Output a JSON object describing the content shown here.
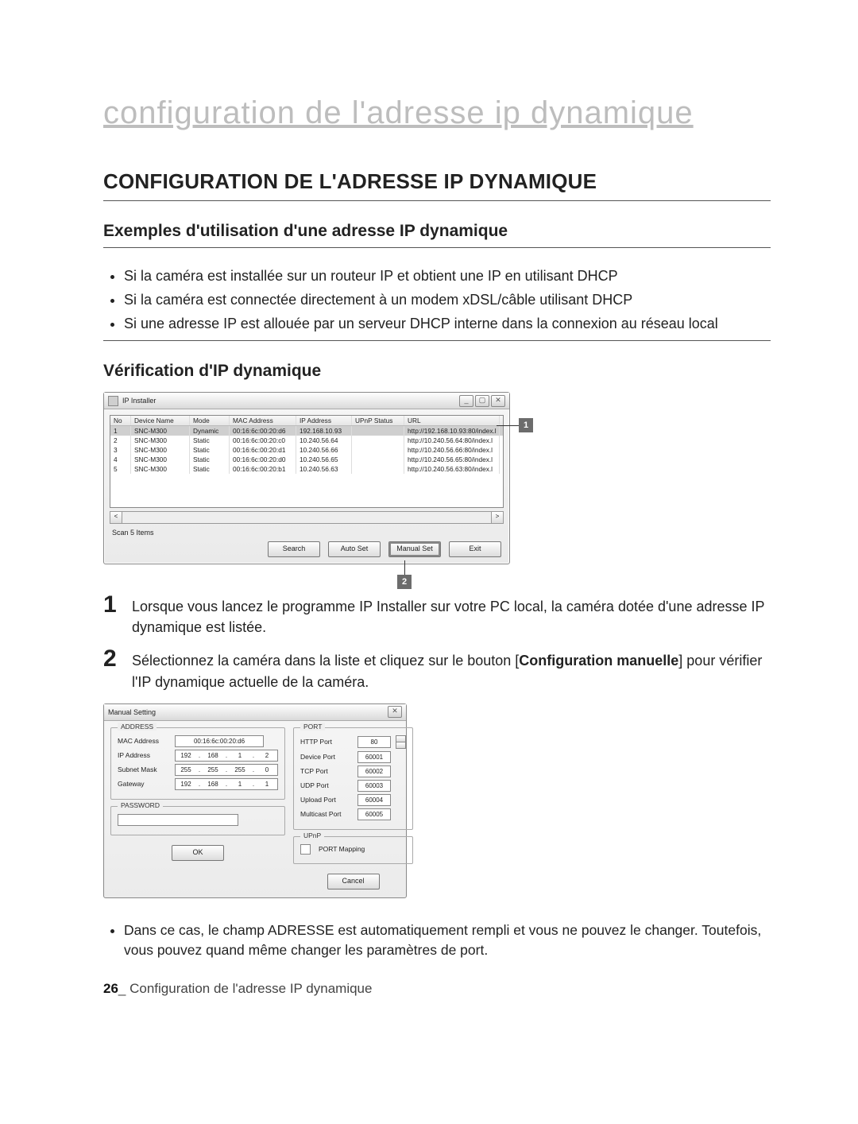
{
  "banner": "configuration de l'adresse ip dynamique",
  "section_title": "CONFIGURATION DE L'ADRESSE IP DYNAMIQUE",
  "sub_examples": "Exemples d'utilisation d'une adresse IP dynamique",
  "bullets_examples": [
    "Si la caméra est installée sur un routeur IP et obtient une IP en utilisant DHCP",
    "Si la caméra est connectée directement à un modem xDSL/câble utilisant DHCP",
    "Si une adresse IP est allouée par un serveur DHCP interne dans la connexion au réseau local"
  ],
  "sub_verify": "Vérification d'IP dynamique",
  "ip_installer": {
    "title": "IP Installer",
    "columns": [
      "No",
      "Device Name",
      "Mode",
      "MAC Address",
      "IP Address",
      "UPnP Status",
      "URL"
    ],
    "rows": [
      {
        "no": "1",
        "name": "SNC-M300",
        "mode": "Dynamic",
        "mac": "00:16:6c:00:20:d6",
        "ip": "192.168.10.93",
        "upnp": "",
        "url": "http://192.168.10.93:80/index.l"
      },
      {
        "no": "2",
        "name": "SNC-M300",
        "mode": "Static",
        "mac": "00:16:6c:00:20:c0",
        "ip": "10.240.56.64",
        "upnp": "",
        "url": "http://10.240.56.64:80/index.l"
      },
      {
        "no": "3",
        "name": "SNC-M300",
        "mode": "Static",
        "mac": "00:16:6c:00:20:d1",
        "ip": "10.240.56.66",
        "upnp": "",
        "url": "http://10.240.56.66:80/index.l"
      },
      {
        "no": "4",
        "name": "SNC-M300",
        "mode": "Static",
        "mac": "00:16:6c:00:20:d0",
        "ip": "10.240.56.65",
        "upnp": "",
        "url": "http://10.240.56.65:80/index.l"
      },
      {
        "no": "5",
        "name": "SNC-M300",
        "mode": "Static",
        "mac": "00:16:6c:00:20:b1",
        "ip": "10.240.56.63",
        "upnp": "",
        "url": "http://10.240.56.63:80/index.l"
      }
    ],
    "status": "Scan 5 Items",
    "buttons": {
      "search": "Search",
      "autoset": "Auto Set",
      "manualset": "Manual Set",
      "exit": "Exit"
    },
    "callouts": {
      "one": "1",
      "two": "2"
    }
  },
  "num1": "Lorsque vous lancez le programme IP Installer sur votre PC local, la caméra dotée d'une adresse IP dynamique est listée.",
  "num2_pre": "Sélectionnez la caméra dans la liste et cliquez sur le bouton [",
  "num2_bold": "Configuration manuelle",
  "num2_post": "] pour vérifier l'IP dynamique actuelle de la caméra.",
  "manual": {
    "title": "Manual Setting",
    "close_x": "✕",
    "address_legend": "ADDRESS",
    "mac_label": "MAC Address",
    "mac_value": "00:16:6c:00:20:d6",
    "ip_label": "IP Address",
    "ip": [
      "192",
      "168",
      "1",
      "2"
    ],
    "subnet_label": "Subnet Mask",
    "subnet": [
      "255",
      "255",
      "255",
      "0"
    ],
    "gw_label": "Gateway",
    "gw": [
      "192",
      "168",
      "1",
      "1"
    ],
    "password_legend": "PASSWORD",
    "port_legend": "PORT",
    "ports": {
      "http": {
        "label": "HTTP Port",
        "val": "80"
      },
      "device": {
        "label": "Device Port",
        "val": "60001"
      },
      "tcp": {
        "label": "TCP Port",
        "val": "60002"
      },
      "udp": {
        "label": "UDP Port",
        "val": "60003"
      },
      "upload": {
        "label": "Upload Port",
        "val": "60004"
      },
      "multicast": {
        "label": "Multicast Port",
        "val": "60005"
      }
    },
    "upnp_legend": "UPnP",
    "upnp_check": "PORT Mapping",
    "ok": "OK",
    "cancel": "Cancel"
  },
  "note_bullet": "Dans ce cas, le champ ADRESSE est automatiquement rempli et vous ne pouvez le changer. Toutefois, vous pouvez quand même changer les paramètres de port.",
  "footer_pagenum": "26",
  "footer_sep": "_",
  "footer_text": " Configuration de l'adresse IP dynamique"
}
